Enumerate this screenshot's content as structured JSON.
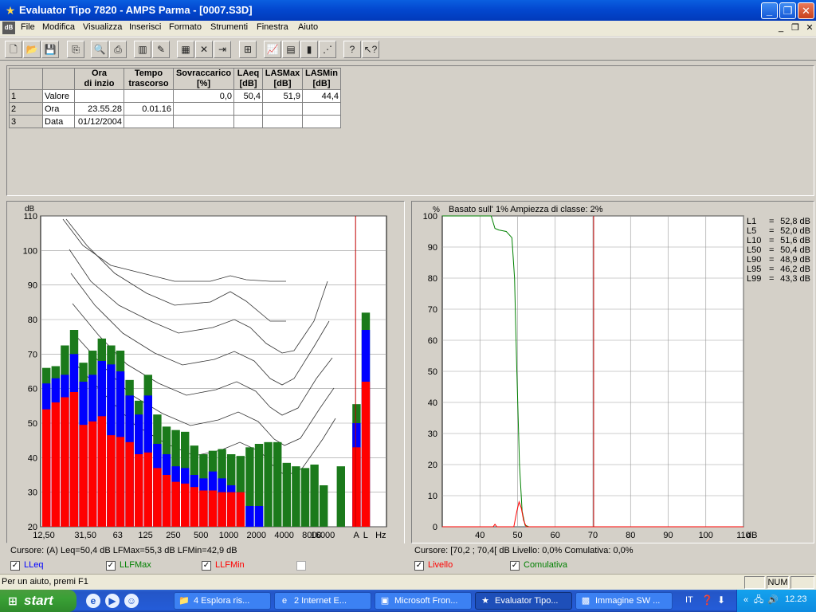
{
  "window": {
    "title": "Evaluator Tipo 7820 - AMPS Parma - [0007.S3D]"
  },
  "menu": {
    "doc_icon": "dB",
    "items": [
      "File",
      "Modifica",
      "Visualizza",
      "Inserisci",
      "Formato",
      "Strumenti",
      "Finestra",
      "Aiuto"
    ]
  },
  "toolbar": {
    "icons": [
      "new-icon",
      "open-icon",
      "save-icon",
      "copy-icon",
      "print-preview-icon",
      "print-icon",
      "measure-icon",
      "edit-icon",
      "grid-icon",
      "delete-icon",
      "import-icon",
      "tree-icon",
      "chart-icon",
      "table-icon",
      "histogram-icon",
      "scatter-icon",
      "help-icon",
      "context-help-icon"
    ]
  },
  "table": {
    "headers": [
      "Ora\ndi inzio",
      "Tempo\ntrascorso",
      "Sovraccarico\n[%]",
      "LAeq\n[dB]",
      "LASMax\n[dB]",
      "LASMin\n[dB]"
    ],
    "rows": [
      {
        "num": "1",
        "label": "Valore",
        "cells": [
          "",
          "",
          "0,0",
          "50,4",
          "51,9",
          "44,4"
        ]
      },
      {
        "num": "2",
        "label": "Ora",
        "cells": [
          "23.55.28",
          "0.01.16",
          "",
          "",
          "",
          ""
        ]
      },
      {
        "num": "3",
        "label": "Data",
        "cells": [
          "01/12/2004",
          "",
          "",
          "",
          "",
          ""
        ]
      }
    ]
  },
  "spectrum": {
    "unit": "dB",
    "status": "Cursore: (A) Leq=50,4 dB  LFMax=55,3 dB  LFMin=42,9 dB",
    "legend": [
      {
        "label": "LLeq",
        "color": "#0000ff",
        "checked": true
      },
      {
        "label": "LLFMax",
        "color": "#008000",
        "checked": true
      },
      {
        "label": "LLFMin",
        "color": "#ff0000",
        "checked": true
      }
    ]
  },
  "distribution": {
    "unit_y": "%",
    "header": "Basato sull' 1%   Ampiezza di classe: 2%",
    "unit_x": "dB",
    "status": "Cursore: [70,2 ; 70,4[ dB   Livello: 0,0%   Comulativa: 0,0%",
    "legend": [
      {
        "label": "Livello",
        "color": "#ff0000",
        "checked": true
      },
      {
        "label": "Comulativa",
        "color": "#008000",
        "checked": true
      }
    ],
    "stats": [
      {
        "name": "L1",
        "value": "52,8 dB"
      },
      {
        "name": "L5",
        "value": "52,0 dB"
      },
      {
        "name": "L10",
        "value": "51,6 dB"
      },
      {
        "name": "L50",
        "value": "50,4 dB"
      },
      {
        "name": "L90",
        "value": "48,9 dB"
      },
      {
        "name": "L95",
        "value": "46,2 dB"
      },
      {
        "name": "L99",
        "value": "43,3 dB"
      }
    ]
  },
  "chart_data": [
    {
      "type": "bar",
      "ylabel": "dB",
      "ylim": [
        20,
        110
      ],
      "yticks": [
        20,
        30,
        40,
        50,
        60,
        70,
        80,
        90,
        100,
        110
      ],
      "xtick_labels": [
        "12,50",
        "31,50",
        "63",
        "125",
        "250",
        "500",
        "1000",
        "2000",
        "4000",
        "8000",
        "16000",
        "A",
        "L",
        "Hz"
      ],
      "series": [
        {
          "name": "LLFMax",
          "color": "#1b7a1b",
          "values": [
            66,
            66.5,
            72.5,
            77,
            67.5,
            71,
            74.5,
            72.5,
            71,
            62.5,
            56.5,
            64,
            52.5,
            49,
            48,
            47.5,
            43.5,
            41,
            42,
            42.5,
            41,
            40.5,
            43,
            44,
            44.5,
            44.5,
            38.5,
            37.5,
            37,
            38,
            32,
            37.5,
            55.5,
            82
          ]
        },
        {
          "name": "LLeq",
          "color": "#0000ff",
          "values": [
            61.5,
            63,
            64,
            70,
            62,
            64,
            68,
            67,
            65,
            58,
            52.5,
            58,
            44,
            41,
            37.5,
            37,
            35,
            34,
            36,
            34,
            32,
            30,
            26,
            26,
            0,
            0,
            0,
            0,
            0,
            0,
            0,
            0,
            50,
            77
          ]
        },
        {
          "name": "LLFMin",
          "color": "#ff0000",
          "values": [
            54,
            56,
            57.5,
            59,
            49.5,
            50.5,
            52,
            46.5,
            46,
            44.5,
            41,
            41.5,
            37,
            35,
            33,
            32.5,
            31.5,
            30.5,
            30.5,
            30,
            30,
            30,
            0,
            0,
            0,
            0,
            0,
            0,
            0,
            0,
            0,
            0,
            43,
            62
          ]
        }
      ],
      "markers": [
        {
          "type": "cursor",
          "x_index": 32,
          "color": "#c00000"
        }
      ]
    },
    {
      "type": "line",
      "ylabel": "%",
      "xlabel": "dB",
      "xlim": [
        30,
        110
      ],
      "ylim": [
        0,
        100
      ],
      "xticks": [
        40,
        50,
        60,
        70,
        80,
        90,
        100,
        110
      ],
      "yticks": [
        0,
        10,
        20,
        30,
        40,
        50,
        60,
        70,
        80,
        90,
        100
      ],
      "series": [
        {
          "name": "Comulativa",
          "color": "#008000",
          "points": [
            [
              30,
              100
            ],
            [
              43,
              100
            ],
            [
              44,
              96
            ],
            [
              45,
              95.5
            ],
            [
              47,
              95
            ],
            [
              48.5,
              93
            ],
            [
              49.2,
              80
            ],
            [
              49.8,
              50
            ],
            [
              50.5,
              20
            ],
            [
              51.2,
              5
            ],
            [
              52,
              0.5
            ],
            [
              53,
              0
            ],
            [
              110,
              0
            ]
          ]
        },
        {
          "name": "Livello",
          "color": "#ff0000",
          "points": [
            [
              30,
              0
            ],
            [
              43.5,
              0
            ],
            [
              44,
              0.8
            ],
            [
              44.5,
              0
            ],
            [
              49,
              0
            ],
            [
              49.8,
              5
            ],
            [
              50.4,
              8
            ],
            [
              51,
              6
            ],
            [
              51.6,
              2
            ],
            [
              52.3,
              0
            ],
            [
              110,
              0
            ]
          ]
        }
      ],
      "markers": [
        {
          "type": "cursor",
          "x": 70.2,
          "color": "#c00000"
        }
      ]
    }
  ],
  "statusbar": {
    "help_text": "Per un aiuto, premi F1",
    "num": "NUM"
  },
  "taskbar": {
    "start_label": "start",
    "tasks": [
      {
        "label": "4 Esplora ris...",
        "icon": "folder-icon",
        "active": false
      },
      {
        "label": "2 Internet E...",
        "icon": "ie-icon",
        "active": false
      },
      {
        "label": "Microsoft Fron...",
        "icon": "frontpage-icon",
        "active": false
      },
      {
        "label": "Evaluator Tipo...",
        "icon": "evaluator-icon",
        "active": true
      },
      {
        "label": "Immagine SW ...",
        "icon": "image-icon",
        "active": false
      }
    ],
    "lang": "IT",
    "clock": "12.23"
  }
}
